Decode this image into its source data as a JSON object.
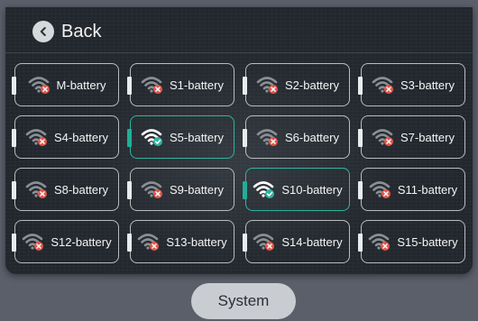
{
  "header": {
    "back_label": "Back"
  },
  "batteries": [
    {
      "label": "M-battery",
      "connected": false
    },
    {
      "label": "S1-battery",
      "connected": false
    },
    {
      "label": "S2-battery",
      "connected": false
    },
    {
      "label": "S3-battery",
      "connected": false
    },
    {
      "label": "S4-battery",
      "connected": false
    },
    {
      "label": "S5-battery",
      "connected": true
    },
    {
      "label": "S6-battery",
      "connected": false
    },
    {
      "label": "S7-battery",
      "connected": false
    },
    {
      "label": "S8-battery",
      "connected": false
    },
    {
      "label": "S9-battery",
      "connected": false
    },
    {
      "label": "S10-battery",
      "connected": true
    },
    {
      "label": "S11-battery",
      "connected": false
    },
    {
      "label": "S12-battery",
      "connected": false
    },
    {
      "label": "S13-battery",
      "connected": false
    },
    {
      "label": "S14-battery",
      "connected": false
    },
    {
      "label": "S15-battery",
      "connected": false
    }
  ],
  "footer": {
    "system_label": "System"
  },
  "icons": {
    "disconnected": "wifi-disconnected-icon",
    "connected": "wifi-connected-icon",
    "back": "chevron-left-icon"
  },
  "colors": {
    "connected_accent": "#2fb5a0",
    "error_badge": "#e0564a",
    "panel_bg": "#22272d"
  }
}
